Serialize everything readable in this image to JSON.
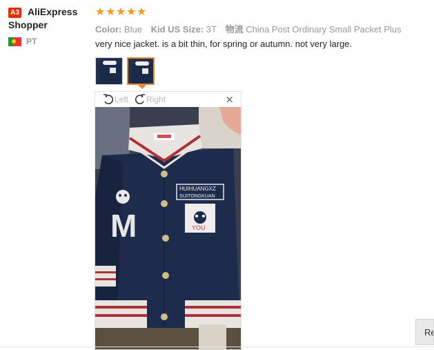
{
  "reviewer": {
    "badge": "A3",
    "name_line1": "AliExpress",
    "name_line2": "Shopper",
    "country_code": "PT"
  },
  "rating": {
    "stars": 5,
    "max": 5,
    "star_color": "#f49b16"
  },
  "attributes": {
    "color_label": "Color:",
    "color_value": "Blue",
    "size_label": "Kid US Size:",
    "size_value": "3T",
    "shipping_label": "物流",
    "shipping_value": "China Post Ordinary Small Packet Plus"
  },
  "review_text": "very nice jacket. is a bit thin, for spring or autumn. not very large.",
  "thumbnails": {
    "count": 2,
    "active_index": 1,
    "active_color": "#e68a2e"
  },
  "viewer": {
    "rotate_left_label": "Left",
    "rotate_right_label": "Right",
    "close_glyph": "×",
    "photo_text": {
      "brand_line1": "HUIHUANGXZ",
      "brand_line2": "SIJITONGKUAN",
      "letter": "M",
      "patch_text": "YOU"
    }
  },
  "side_tab_label": "Re",
  "colors": {
    "badge_red": "#e62e04",
    "jacket_navy": "#1d2b4c",
    "stripe_red": "#b0303a"
  }
}
